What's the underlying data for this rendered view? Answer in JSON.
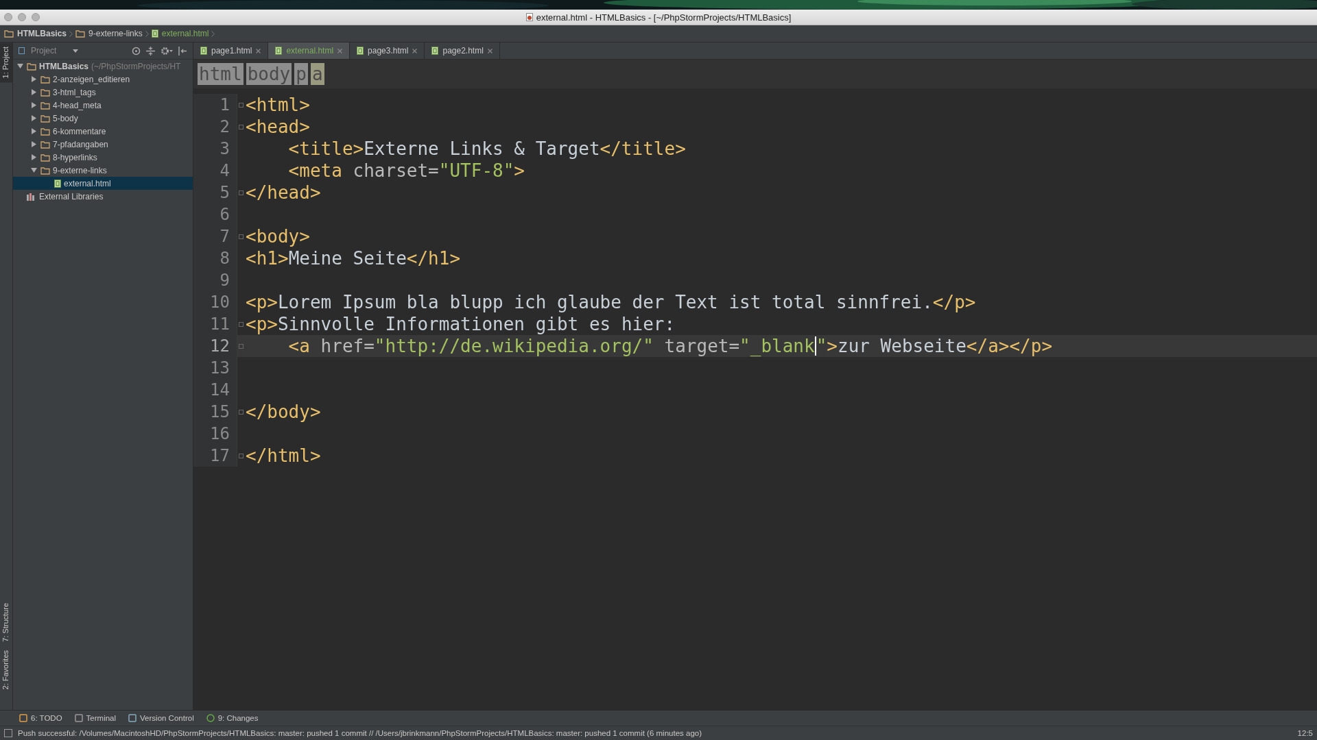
{
  "window": {
    "title": "external.html - HTMLBasics - [~/PhpStormProjects/HTMLBasics]"
  },
  "navigation_bar": [
    {
      "label": "HTMLBasics",
      "kind": "folder",
      "selected": false
    },
    {
      "label": "9-externe-links",
      "kind": "folder",
      "selected": false
    },
    {
      "label": "external.html",
      "kind": "file",
      "selected": true
    }
  ],
  "left_tool_strip": [
    {
      "label": "1: Project",
      "selected": true
    },
    {
      "label": "7: Structure",
      "selected": false
    },
    {
      "label": "2: Favorites",
      "selected": false
    }
  ],
  "project_panel": {
    "view": "Project",
    "tree": [
      {
        "label": "HTMLBasics",
        "path": "(~/PhpStormProjects/HT",
        "kind": "folder",
        "expanded": true,
        "selected": false,
        "children": [
          {
            "label": "2-anzeigen_editieren",
            "kind": "folder",
            "expanded": false,
            "selected": false
          },
          {
            "label": "3-html_tags",
            "kind": "folder",
            "expanded": false,
            "selected": false
          },
          {
            "label": "4-head_meta",
            "kind": "folder",
            "expanded": false,
            "selected": false
          },
          {
            "label": "5-body",
            "kind": "folder",
            "expanded": false,
            "selected": false
          },
          {
            "label": "6-kommentare",
            "kind": "folder",
            "expanded": false,
            "selected": false
          },
          {
            "label": "7-pfadangaben",
            "kind": "folder",
            "expanded": false,
            "selected": false
          },
          {
            "label": "8-hyperlinks",
            "kind": "folder",
            "expanded": false,
            "selected": false
          },
          {
            "label": "9-externe-links",
            "kind": "folder",
            "expanded": true,
            "selected": false,
            "children": [
              {
                "label": "external.html",
                "kind": "file",
                "selected": true
              }
            ]
          }
        ]
      },
      {
        "label": "External Libraries",
        "kind": "library",
        "selected": false
      }
    ]
  },
  "tabs": [
    {
      "label": "page1.html",
      "selected": false
    },
    {
      "label": "external.html",
      "selected": true
    },
    {
      "label": "page3.html",
      "selected": false
    },
    {
      "label": "page2.html",
      "selected": false
    }
  ],
  "editor_breadcrumb": [
    {
      "label": "html",
      "selected": false
    },
    {
      "label": "body",
      "selected": false
    },
    {
      "label": "p",
      "selected": false
    },
    {
      "label": "a",
      "selected": true
    }
  ],
  "code_lines": [
    {
      "number": "1",
      "fold": true,
      "current": false,
      "tokens": [
        {
          "kind": "tag",
          "text": "<html>"
        }
      ]
    },
    {
      "number": "2",
      "fold": true,
      "current": false,
      "tokens": [
        {
          "kind": "tag",
          "text": "<head>"
        }
      ]
    },
    {
      "number": "3",
      "fold": false,
      "current": false,
      "indent": true,
      "tokens": [
        {
          "kind": "tag",
          "text": "<title>"
        },
        {
          "kind": "text",
          "text": "Externe Links & Target"
        },
        {
          "kind": "tag",
          "text": "</title>"
        }
      ]
    },
    {
      "number": "4",
      "fold": false,
      "current": false,
      "indent": true,
      "tokens": [
        {
          "kind": "tag",
          "text": "<meta "
        },
        {
          "kind": "attr",
          "text": "charset="
        },
        {
          "kind": "value",
          "text": "\"UTF-8\""
        },
        {
          "kind": "tag",
          "text": ">"
        }
      ]
    },
    {
      "number": "5",
      "fold": true,
      "current": false,
      "tokens": [
        {
          "kind": "tag",
          "text": "</head>"
        }
      ]
    },
    {
      "number": "6",
      "fold": false,
      "current": false
    },
    {
      "number": "7",
      "fold": true,
      "current": false,
      "tokens": [
        {
          "kind": "tag",
          "text": "<body>"
        }
      ]
    },
    {
      "number": "8",
      "fold": false,
      "current": false,
      "tokens": [
        {
          "kind": "tag",
          "text": "<h1>"
        },
        {
          "kind": "text",
          "text": "Meine Seite"
        },
        {
          "kind": "tag",
          "text": "</h1>"
        }
      ]
    },
    {
      "number": "9",
      "fold": false,
      "current": false
    },
    {
      "number": "10",
      "fold": false,
      "current": false,
      "tokens": [
        {
          "kind": "tag",
          "text": "<p>"
        },
        {
          "kind": "text",
          "text": "Lorem Ipsum bla blupp ich glaube der Text ist total sinnfrei."
        },
        {
          "kind": "tag",
          "text": "</p>"
        }
      ]
    },
    {
      "number": "11",
      "fold": true,
      "current": false,
      "tokens": [
        {
          "kind": "tag",
          "text": "<p>"
        },
        {
          "kind": "text",
          "text": "Sinnvolle Informationen gibt es hier:"
        }
      ]
    },
    {
      "number": "12",
      "fold": true,
      "current": true,
      "indent": true,
      "tokens": [
        {
          "kind": "tag",
          "text": "<a "
        },
        {
          "kind": "attr",
          "text": "href="
        },
        {
          "kind": "value",
          "text": "\"http://de.wikipedia.org/\""
        },
        {
          "kind": "attr",
          "text": " target="
        },
        {
          "kind": "value",
          "text": "\"_blank",
          "caret_after": true
        },
        {
          "kind": "value",
          "text": "\""
        },
        {
          "kind": "tag",
          "text": ">"
        },
        {
          "kind": "text",
          "text": "zur Webseite"
        },
        {
          "kind": "tag",
          "text": "</a></p>"
        }
      ]
    },
    {
      "number": "13",
      "fold": false,
      "current": false
    },
    {
      "number": "14",
      "fold": false,
      "current": false
    },
    {
      "number": "15",
      "fold": true,
      "current": false,
      "tokens": [
        {
          "kind": "tag",
          "text": "</body>"
        }
      ]
    },
    {
      "number": "16",
      "fold": false,
      "current": false
    },
    {
      "number": "17",
      "fold": true,
      "current": false,
      "tokens": [
        {
          "kind": "tag",
          "text": "</html>"
        }
      ]
    }
  ],
  "tool_windows": [
    {
      "label": "6: TODO",
      "kind": "todo"
    },
    {
      "label": "Terminal",
      "kind": "terminal"
    },
    {
      "label": "Version Control",
      "kind": "vcs"
    },
    {
      "label": "9: Changes",
      "kind": "changes"
    }
  ],
  "status_bar": {
    "message": "Push successful: /Volumes/MacintoshHD/PhpStormProjects/HTMLBasics: master: pushed 1 commit // /Users/jbrinkmann/PhpStormProjects/HTMLBasics: master: pushed 1 commit (6 minutes ago)",
    "position": "12:5"
  }
}
